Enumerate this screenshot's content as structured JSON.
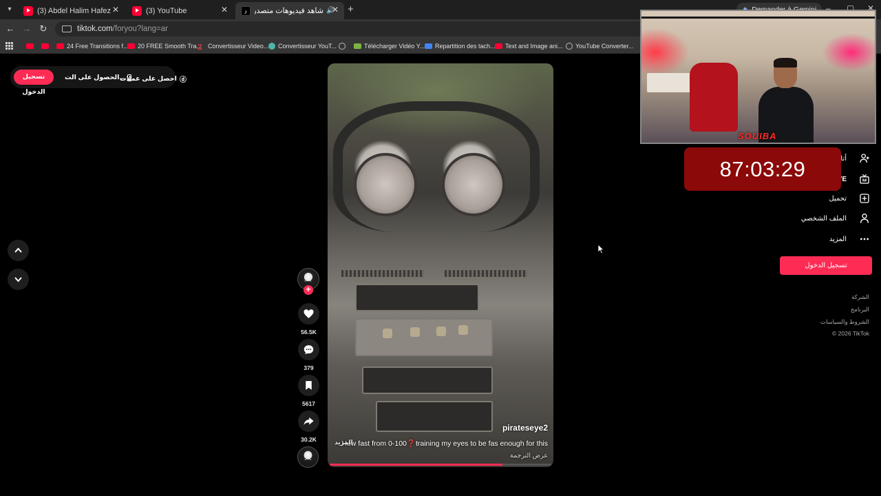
{
  "browser": {
    "tabs": [
      {
        "title": "(3) Abdel Halim Hafez - Ala Hesb",
        "icon": "youtube-icon"
      },
      {
        "title": "(3) YouTube",
        "icon": "youtube-icon"
      },
      {
        "title": "شاهد فيديوهات متصدرة | TikTok",
        "icon": "tiktok-icon"
      }
    ],
    "new_tab": "+",
    "gemini_label": "Demander à Gemini",
    "url_host": "tiktok.com",
    "url_path": "/foryou?lang=ar"
  },
  "bookmarks": [
    {
      "label": "",
      "icon": "youtube-icon"
    },
    {
      "label": "",
      "icon": "youtube-icon"
    },
    {
      "label": "24 Free Transitions f...",
      "icon": "youtube-icon"
    },
    {
      "label": "20 FREE Smooth Tra...",
      "icon": "youtube-icon"
    },
    {
      "label": "Convertisseur Video...",
      "icon": "z-icon"
    },
    {
      "label": "Convertisseur YouT...",
      "icon": "converter-icon"
    },
    {
      "label": "",
      "icon": "globe-icon"
    },
    {
      "label": "Télécharger Vidéo Y...",
      "icon": "download-icon"
    },
    {
      "label": "Repartition des tach...",
      "icon": "docs-icon"
    },
    {
      "label": "Text and Image ani...",
      "icon": "youtube-icon"
    },
    {
      "label": "YouTube Converter...",
      "icon": "globe-icon"
    }
  ],
  "tiktok": {
    "top_bar": {
      "login": "تسجيل الدخول",
      "get_app": "الحصول على الت...",
      "get_coins": "احصل على عملات"
    },
    "video": {
      "username": "pirateseye2",
      "caption": "How fast from 0-100❓training my eyes to be fas enough for this",
      "more": "المزيد",
      "translate": "عرض الترجمة",
      "progress": 0.78
    },
    "actions": {
      "likes": "56.5K",
      "comments": "379",
      "saves": "5617",
      "shares": "30.2K"
    },
    "sidebar": {
      "following": "أتابعه",
      "live": "LIVE",
      "upload": "تحميل",
      "profile": "الملف الشخصي",
      "more": "المزيد",
      "login_button": "تسجيل الدخول",
      "footer": [
        "الشركة",
        "البرنامج",
        "الشروط والسياسات",
        "© 2026 TikTok"
      ]
    }
  },
  "overlay": {
    "timer": "87:03:29",
    "cam_tag": "SOUIBA"
  },
  "colors": {
    "tiktok_pink": "#fe2c55",
    "timer_bg": "#8b0909"
  }
}
